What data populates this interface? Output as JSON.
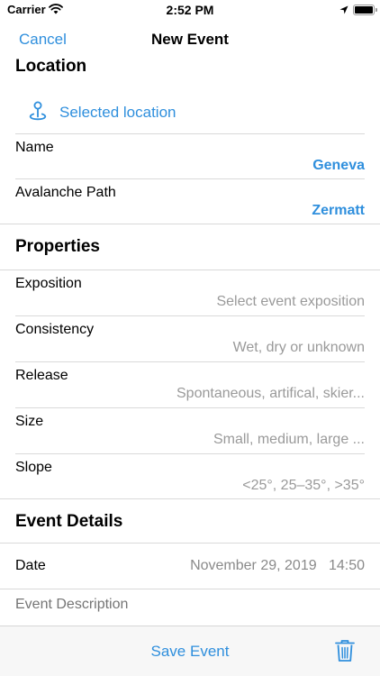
{
  "status_bar": {
    "carrier": "Carrier",
    "time": "2:52 PM"
  },
  "nav": {
    "cancel_label": "Cancel",
    "title": "New Event"
  },
  "location_section": {
    "header": "Location",
    "selected_location_label": "Selected location",
    "rows": [
      {
        "label": "Name",
        "value": "Geneva"
      },
      {
        "label": "Avalanche Path",
        "value": "Zermatt"
      }
    ]
  },
  "properties_section": {
    "header": "Properties",
    "rows": [
      {
        "label": "Exposition",
        "placeholder": "Select event exposition"
      },
      {
        "label": "Consistency",
        "placeholder": "Wet, dry or unknown"
      },
      {
        "label": "Release",
        "placeholder": "Spontaneous, artifical, skier..."
      },
      {
        "label": "Size",
        "placeholder": "Small, medium, large ..."
      },
      {
        "label": "Slope",
        "placeholder": "<25°, 25–35°, >35°"
      }
    ]
  },
  "details_section": {
    "header": "Event Details",
    "date_label": "Date",
    "date_value": "November 29, 2019",
    "time_value": "14:50",
    "description_placeholder": "Event Description"
  },
  "toolbar": {
    "save_label": "Save Event"
  },
  "colors": {
    "accent": "#2f8fdd",
    "placeholder": "#9a9a9a",
    "divider": "#d9d9d9",
    "toolbar_bg": "#f7f7f7"
  },
  "icons": {
    "status_wifi": "wifi-icon",
    "status_location": "location-arrow-icon",
    "status_battery": "battery-icon",
    "location": "map-pin-icon",
    "delete": "trash-icon"
  }
}
